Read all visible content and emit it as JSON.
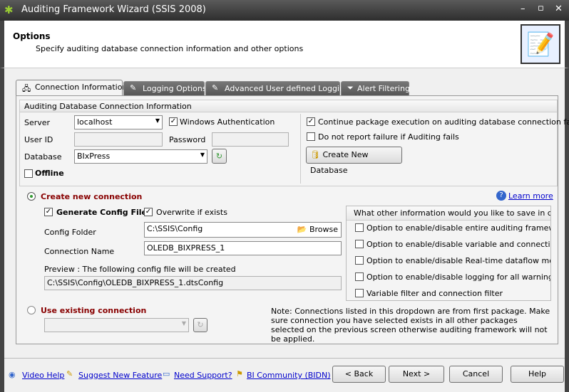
{
  "window": {
    "title": "Auditing Framework Wizard (SSIS 2008)"
  },
  "header": {
    "title": "Options",
    "subtitle": "Specify auditing database connection information and other options"
  },
  "tabs": [
    {
      "label": "Connection Information"
    },
    {
      "label": "Logging Options"
    },
    {
      "label": "Advanced User defined Logging"
    },
    {
      "label": "Alert Filtering"
    }
  ],
  "db_group": {
    "title": "Auditing Database Connection Information",
    "server_label": "Server",
    "server_value": "localhost",
    "windows_auth_label": "Windows Authentication",
    "windows_auth_checked": true,
    "userid_label": "User ID",
    "password_label": "Password",
    "database_label": "Database",
    "database_value": "BIxPress",
    "offline_label": "Offline",
    "continue_label": "Continue package execution on auditing database connection failure",
    "continue_checked": true,
    "noreport_label": "Do not report failure if Auditing fails",
    "create_db_label": "Create New Database"
  },
  "create_conn": {
    "label": "Create new connection",
    "selected": true,
    "gen_config_label": "Generate Config File",
    "overwrite_label": "Overwrite if exists",
    "folder_label": "Config Folder",
    "folder_value": "C:\\SSIS\\Config",
    "browse_label": "Browse",
    "name_label": "Connection Name",
    "name_value": "OLEDB_BIXPRESS_1",
    "preview_label": "Preview : The following config file will be created",
    "preview_value": "C:\\SSIS\\Config\\OLEDB_BIXPRESS_1.dtsConfig",
    "learn_more": "Learn more"
  },
  "config_options": {
    "title": "What other information would you like to save in config fil",
    "items": [
      "Option to enable/disable entire auditing framework",
      "Option to enable/disable variable and connection loggi",
      "Option to enable/disable Real-time dataflow monitoring",
      "Option to enable/disable logging for all warnings",
      "Variable filter and connection filter"
    ]
  },
  "existing_conn": {
    "label": "Use existing connection",
    "note": "Note: Connections listed in this dropdown are from first package. Make sure connection you have selected exists in all other packages selected on the previous screen otherwise auditing framework will not be applied."
  },
  "footer": {
    "links": [
      "Video Help",
      "Suggest New Feature",
      "Need Support?",
      "BI Community (BIDN)"
    ],
    "buttons": [
      "< Back",
      "Next >",
      "Cancel",
      "Help"
    ]
  }
}
